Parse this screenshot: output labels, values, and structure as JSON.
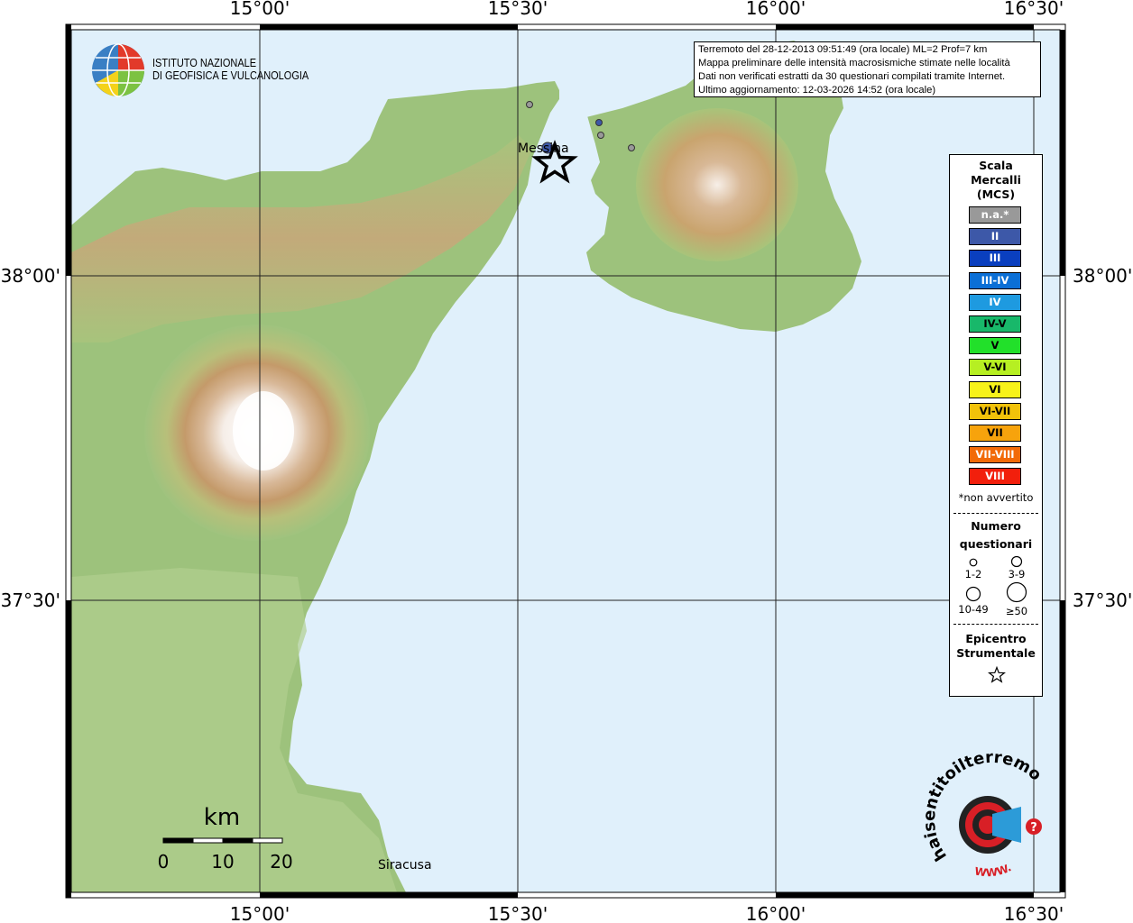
{
  "map": {
    "x_tick_labels": [
      "15°00'",
      "15°30'",
      "16°00'",
      "16°30'"
    ],
    "y_tick_labels": [
      "38°00'",
      "37°30'"
    ],
    "place_labels": [
      "Messina",
      "Siracusa"
    ],
    "scale_bar": {
      "unit": "km",
      "ticks": [
        "0",
        "10",
        "20"
      ]
    },
    "sea_color": "#e0f0fb",
    "epicenter_icon": "star-icon"
  },
  "logo": {
    "line1": "ISTITUTO NAZIONALE",
    "line2": "DI GEOFISICA E VULCANOLOGIA"
  },
  "info": {
    "line1": "Terremoto del 28-12-2013 09:51:49 (ora locale) ML=2 Prof=7 km",
    "line2": "Mappa preliminare delle intensità macrosismiche stimate nelle località",
    "line3": "Dati non verificati estratti da 30 questionari compilati tramite Internet.",
    "line4": "Ultimo aggiornamento: 12-03-2026 14:52 (ora locale)"
  },
  "legend": {
    "title_line1": "Scala",
    "title_line2": "Mercalli",
    "title_line3": "(MCS)",
    "scale": [
      {
        "label": "n.a.*",
        "color": "#999999"
      },
      {
        "label": "II",
        "color": "#3d58a8"
      },
      {
        "label": "III",
        "color": "#0a3fbf"
      },
      {
        "label": "III-IV",
        "color": "#0b6fd6"
      },
      {
        "label": "IV",
        "color": "#1e9ae0"
      },
      {
        "label": "IV-V",
        "color": "#18b86a"
      },
      {
        "label": "V",
        "color": "#22e02a"
      },
      {
        "label": "V-VI",
        "color": "#b6ef22"
      },
      {
        "label": "VI",
        "color": "#f7f21a"
      },
      {
        "label": "VI-VII",
        "color": "#f2c20a"
      },
      {
        "label": "VII",
        "color": "#f7a30c"
      },
      {
        "label": "VII-VIII",
        "color": "#f26a08"
      },
      {
        "label": "VIII",
        "color": "#f21f0c"
      }
    ],
    "note": "*non avvertito",
    "count_title_line1": "Numero",
    "count_title_line2": "questionari",
    "count_labels": [
      "1-2",
      "3-9",
      "10-49",
      "≥50"
    ],
    "epicenter_line1": "Epicentro",
    "epicenter_line2": "Strumentale"
  },
  "watermark": {
    "text": "haisentitoilterremoto.it",
    "url_text": "WWW."
  }
}
